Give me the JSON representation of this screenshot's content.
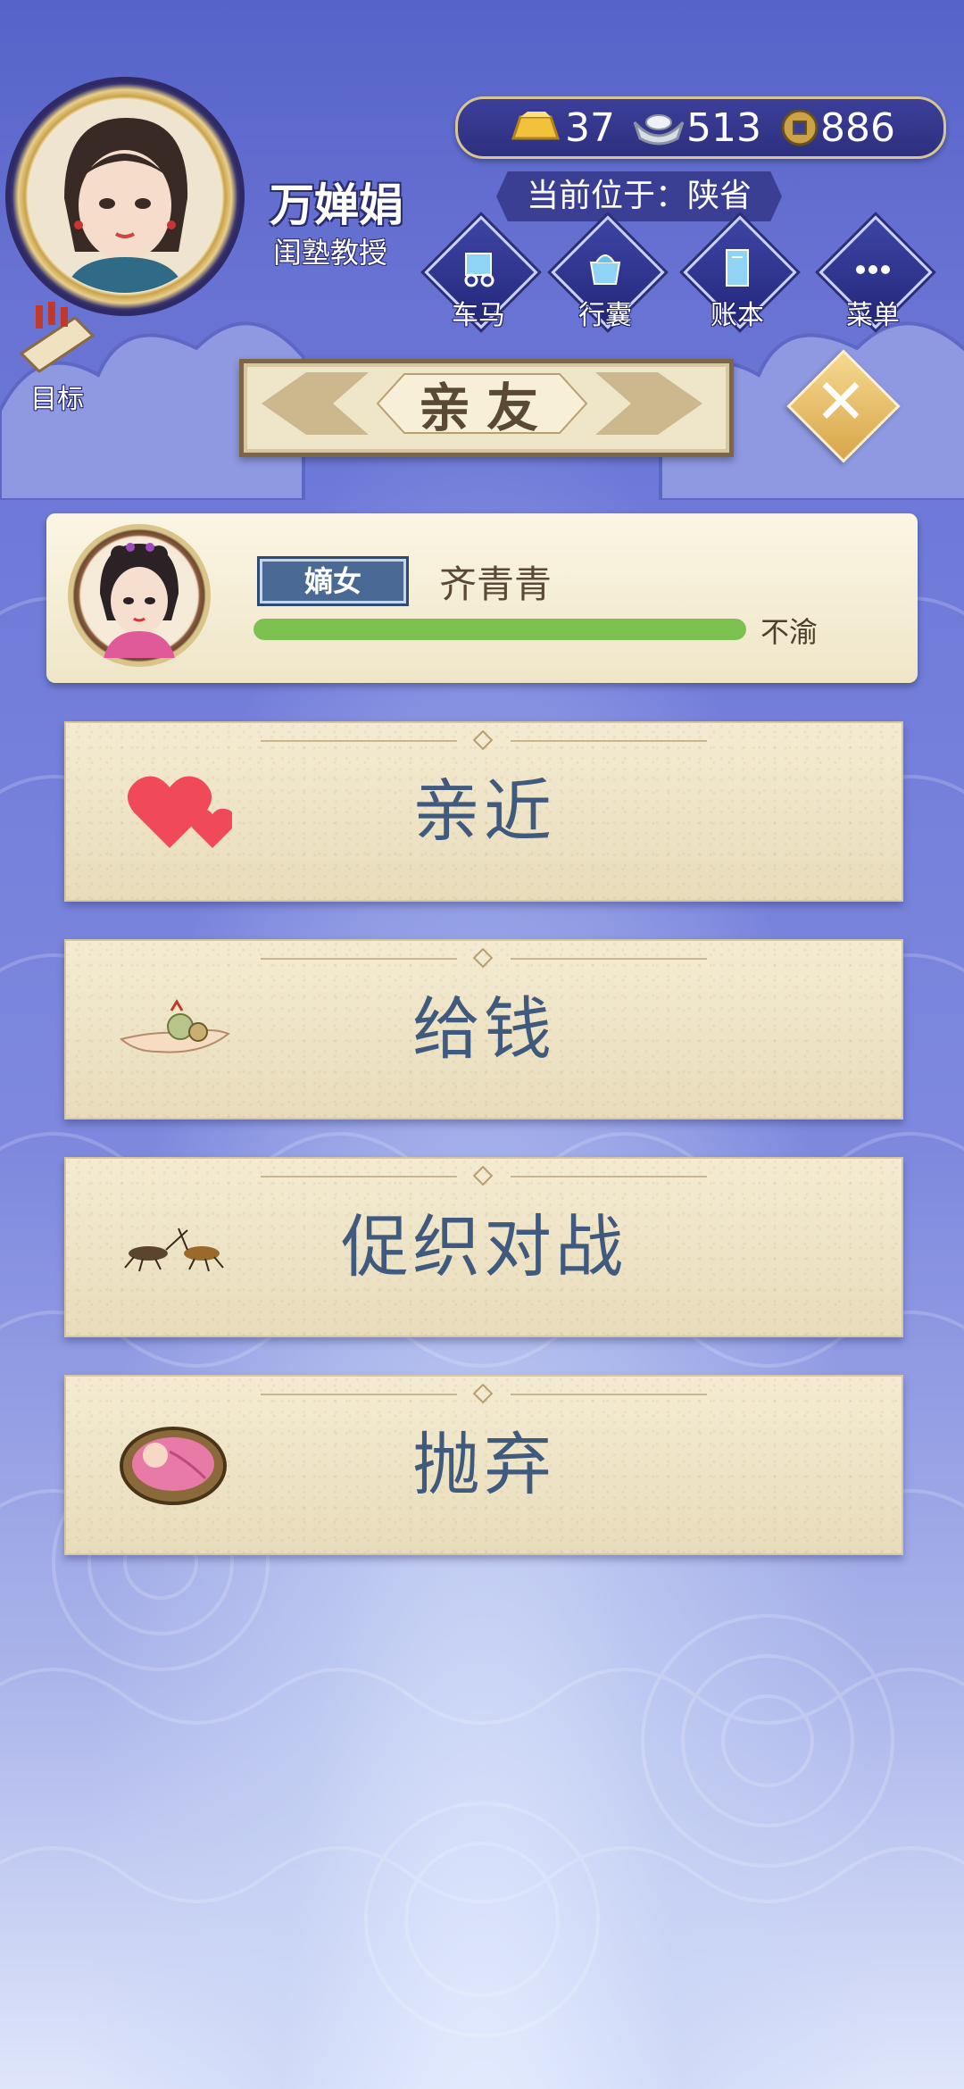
{
  "player": {
    "name": "万婵娟",
    "title": "闺塾教授",
    "location": "当前位于：陕省"
  },
  "currency": {
    "gold": "37",
    "silver": "513",
    "coin": "886"
  },
  "nav": [
    {
      "label": "车马",
      "icon": "carriage-icon"
    },
    {
      "label": "行囊",
      "icon": "bag-icon"
    },
    {
      "label": "账本",
      "icon": "ledger-icon"
    },
    {
      "label": "菜单",
      "icon": "menu-dots-icon"
    }
  ],
  "goal": {
    "label": "目标"
  },
  "panel": {
    "title": "亲友"
  },
  "friend": {
    "rank": "嫡女",
    "name": "齐青青",
    "mood_label": "不渝",
    "mood_level": 1.0
  },
  "actions": [
    {
      "label": "亲近",
      "icon": "hearts-icon"
    },
    {
      "label": "给钱",
      "icon": "money-hand-icon"
    },
    {
      "label": "促织对战",
      "icon": "crickets-icon"
    },
    {
      "label": "抛弃",
      "icon": "baby-basket-icon"
    }
  ],
  "colors": {
    "background_top": "#5663c8",
    "background_bottom": "#dfe6fb",
    "card": "#efe4c6",
    "action_text": "#3f5a7d",
    "mood_bar": "#7cc050",
    "rank_badge": "#4a6a95"
  }
}
